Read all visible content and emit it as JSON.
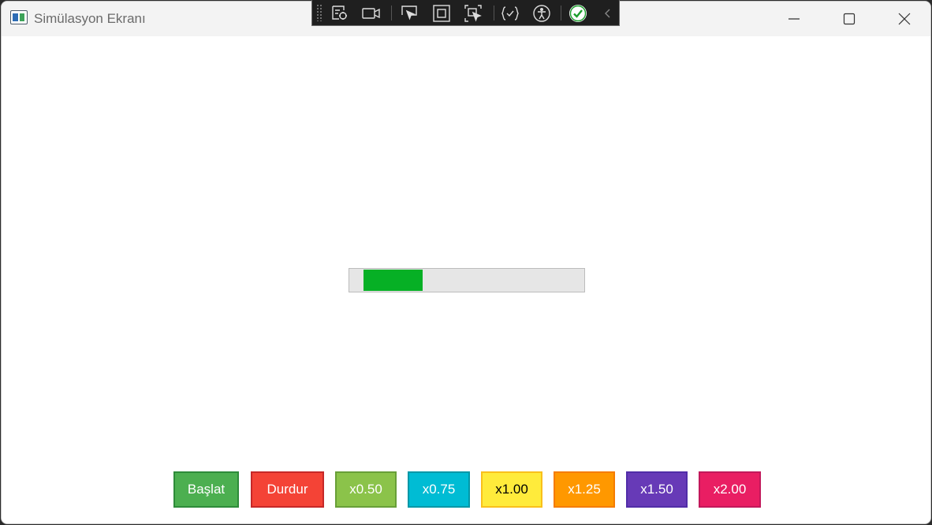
{
  "window": {
    "title": "Simülasyon Ekranı",
    "controls": [
      "minimize-icon",
      "maximize-icon",
      "close-icon"
    ]
  },
  "devtools_toolbar": {
    "items": [
      "live-visual-tree-icon",
      "camera-icon",
      "select-element-icon",
      "display-layout-adorners-icon",
      "track-focus-icon",
      "hot-reload-icon",
      "accessibility-icon",
      "checkmark-icon",
      "collapse-chevron-icon"
    ]
  },
  "progress": {
    "value_fraction": 0.25,
    "fill_color": "#06b025"
  },
  "buttons": [
    {
      "label": "Başlat",
      "bg": "#4caf50",
      "border": "#2e8b3a",
      "text": "#ffffff"
    },
    {
      "label": "Durdur",
      "bg": "#f44336",
      "border": "#c62828",
      "text": "#ffffff"
    },
    {
      "label": "x0.50",
      "bg": "#8bc34a",
      "border": "#689f38",
      "text": "#ffffff"
    },
    {
      "label": "x0.75",
      "bg": "#00bcd4",
      "border": "#0097a7",
      "text": "#ffffff"
    },
    {
      "label": "x1.00",
      "bg": "#ffeb3b",
      "border": "#f9c01b",
      "text": "#000000"
    },
    {
      "label": "x1.25",
      "bg": "#ff9800",
      "border": "#f57c00",
      "text": "#ffffff"
    },
    {
      "label": "x1.50",
      "bg": "#673ab7",
      "border": "#512da8",
      "text": "#ffffff"
    },
    {
      "label": "x2.00",
      "bg": "#e91e63",
      "border": "#c2185b",
      "text": "#ffffff"
    }
  ]
}
